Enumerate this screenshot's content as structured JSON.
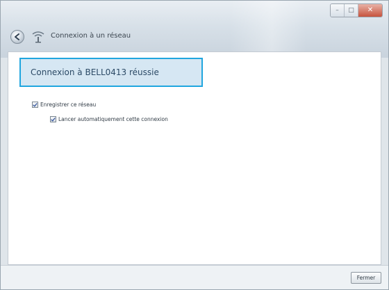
{
  "window": {
    "title": "Connexion à un réseau",
    "controls": {
      "minimize": "–",
      "maximize": "□",
      "close": "✕"
    }
  },
  "status": {
    "message": "Connexion à BELL0413 réussie"
  },
  "options": {
    "save_network": {
      "label": "Enregistrer ce réseau",
      "checked": true
    },
    "auto_connect": {
      "label": "Lancer automatiquement cette connexion",
      "checked": true
    }
  },
  "footer": {
    "close_label": "Fermer"
  },
  "icons": {
    "back": "back-arrow-icon",
    "network": "network-icon",
    "check": "check-icon"
  },
  "colors": {
    "banner_border": "#20a6df",
    "banner_background": "#d6e7f3",
    "window_background": "#dfe5ea"
  }
}
